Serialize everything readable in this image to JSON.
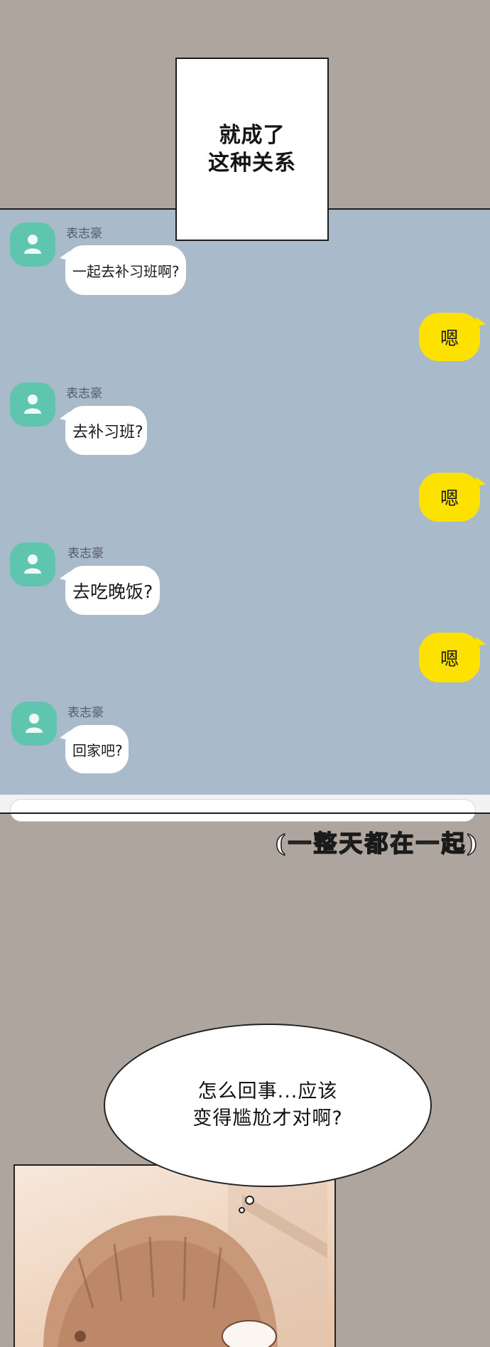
{
  "caption_box": {
    "lines": [
      "就成了",
      "这种关系"
    ]
  },
  "chat": {
    "messages": [
      {
        "side": "left",
        "sender": "表志豪",
        "text": "一起去补习班啊?"
      },
      {
        "side": "right",
        "text": "嗯"
      },
      {
        "side": "left",
        "sender": "表志豪",
        "text": "去补习班?"
      },
      {
        "side": "right",
        "text": "嗯"
      },
      {
        "side": "left",
        "sender": "表志豪",
        "text": "去吃晚饭?"
      },
      {
        "side": "right",
        "text": "嗯"
      },
      {
        "side": "left",
        "sender": "表志豪",
        "text": "回家吧?"
      }
    ]
  },
  "handwritten_caption": "(一整天都在一起)",
  "thought_bubble": {
    "lines": [
      "怎么回事...应该",
      "变得尴尬才对啊?"
    ]
  },
  "colors": {
    "page_bg": "#ada59e",
    "chat_bg": "#a9bacb",
    "avatar": "#5fc5ae",
    "my_bubble": "#fde200",
    "their_bubble": "#ffffff"
  },
  "icons": {
    "avatar": "person-icon"
  }
}
